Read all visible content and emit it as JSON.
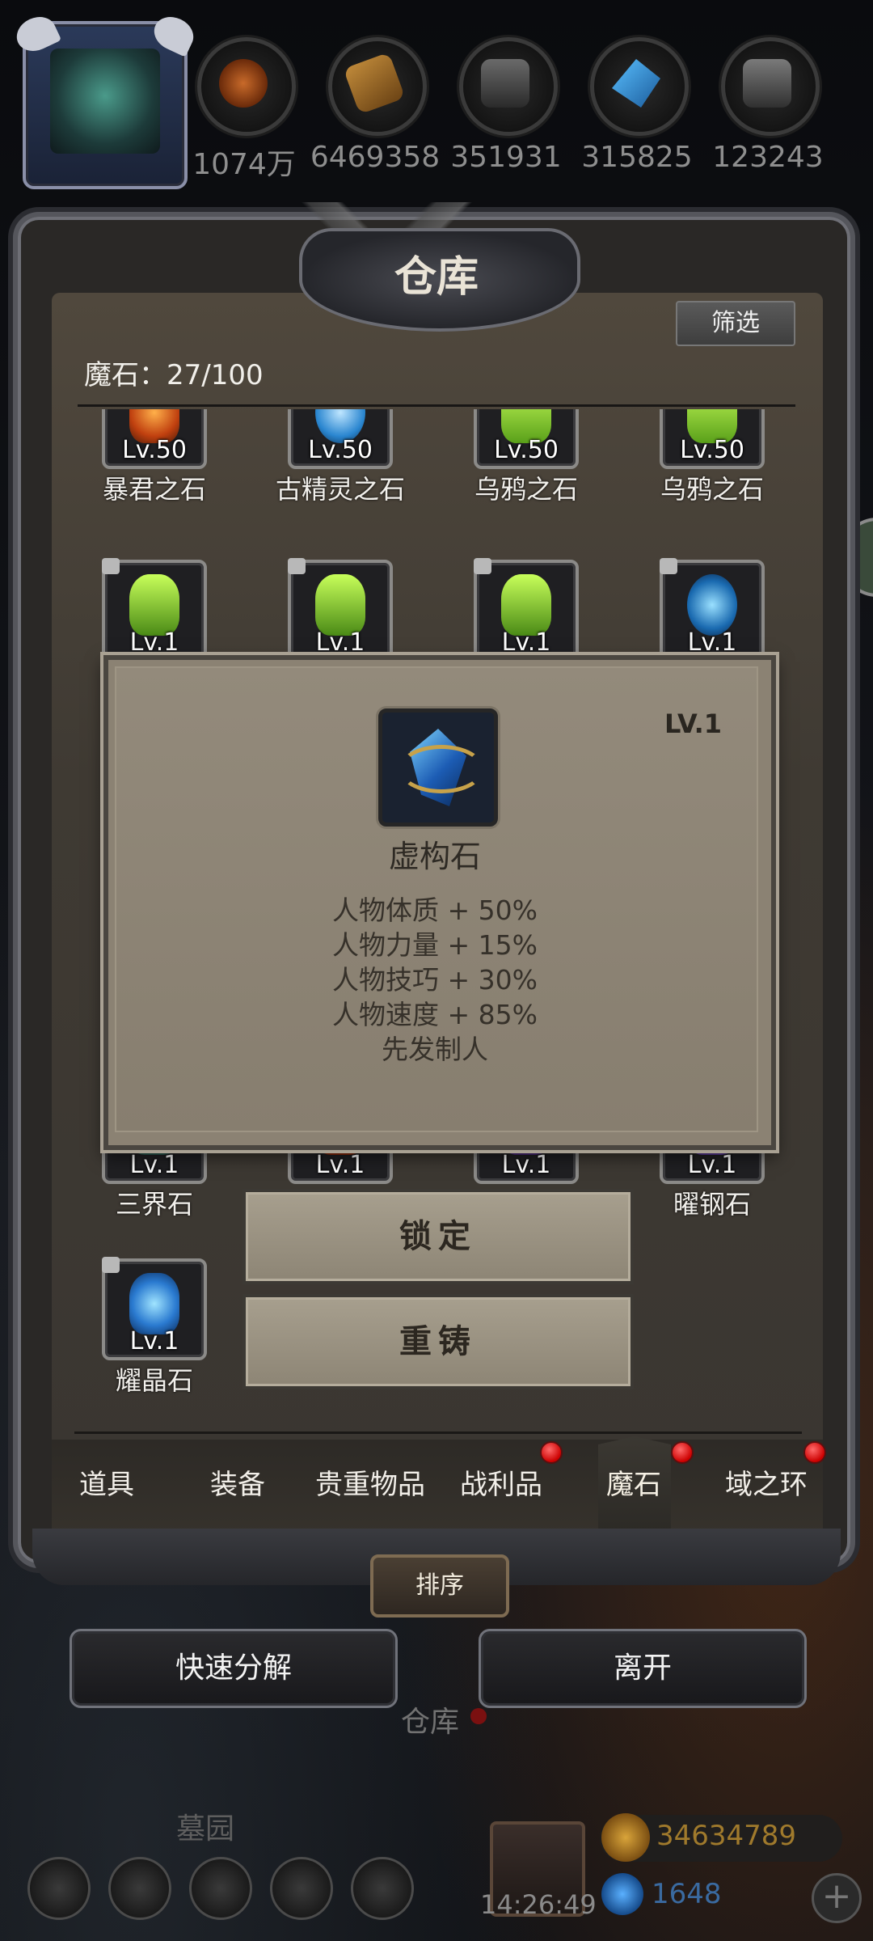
{
  "resources": [
    {
      "icon": "leather-icon",
      "value": "1074万",
      "color": "#b4531f"
    },
    {
      "icon": "wood-icon",
      "value": "6469358",
      "color": "#a06a2a"
    },
    {
      "icon": "ore-icon",
      "value": "351931",
      "color": "#5a5a5a"
    },
    {
      "icon": "crystal-icon",
      "value": "315825",
      "color": "#2d86c8"
    },
    {
      "icon": "iron-icon",
      "value": "123243",
      "color": "#6a6a6a"
    }
  ],
  "panel": {
    "title": "仓库",
    "filter_label": "筛选",
    "count_label": "魔石：27/100"
  },
  "items_row1": [
    {
      "level": "Lv.50",
      "name": "暴君之石",
      "gem": "#e0661f"
    },
    {
      "level": "Lv.50",
      "name": "古精灵之石",
      "gem": "#4aa6e8"
    },
    {
      "level": "Lv.50",
      "name": "乌鸦之石",
      "gem": "#8ad63a"
    },
    {
      "level": "Lv.50",
      "name": "乌鸦之石",
      "gem": "#8ad63a"
    }
  ],
  "items_row2": [
    {
      "level": "Lv.1",
      "gem": "#7ad13a"
    },
    {
      "level": "Lv.1",
      "gem": "#7ad13a"
    },
    {
      "level": "Lv.1",
      "gem": "#7ad13a"
    },
    {
      "level": "Lv.1",
      "gem": "#3a8ad6"
    }
  ],
  "items_row3": [
    {
      "level": "Lv.1",
      "name": "三界石",
      "gem": "#4a8a7a"
    },
    {
      "level": "Lv.1",
      "name": "",
      "gem": "#c4502a"
    },
    {
      "level": "Lv.1",
      "name": "",
      "gem": "#7a5aa0"
    },
    {
      "level": "Lv.1",
      "name": "曜钢石",
      "gem": "#8a6ac0"
    }
  ],
  "items_row4": [
    {
      "level": "Lv.1",
      "name": "耀晶石",
      "gem": "#3a9ae0"
    }
  ],
  "tooltip": {
    "level": "LV.1",
    "name": "虚构石",
    "stats": [
      "人物体质 + 50%",
      "人物力量 + 15%",
      "人物技巧 + 30%",
      "人物速度 + 85%",
      "先发制人"
    ]
  },
  "actions": {
    "lock": "锁定",
    "reforge": "重铸"
  },
  "tabs": [
    {
      "label": "道具",
      "badge": false
    },
    {
      "label": "装备",
      "badge": false
    },
    {
      "label": "贵重物品",
      "badge": false
    },
    {
      "label": "战利品",
      "badge": true
    },
    {
      "label": "魔石",
      "badge": true,
      "active": true
    },
    {
      "label": "域之环",
      "badge": true
    }
  ],
  "sort_label": "排序",
  "bottom": {
    "decompose": "快速分解",
    "leave": "离开"
  },
  "world": {
    "warehouse_label": "仓库",
    "cemetery_label": "墓园",
    "time": "14:26:49",
    "gold": "34634789",
    "gems": "1648"
  }
}
